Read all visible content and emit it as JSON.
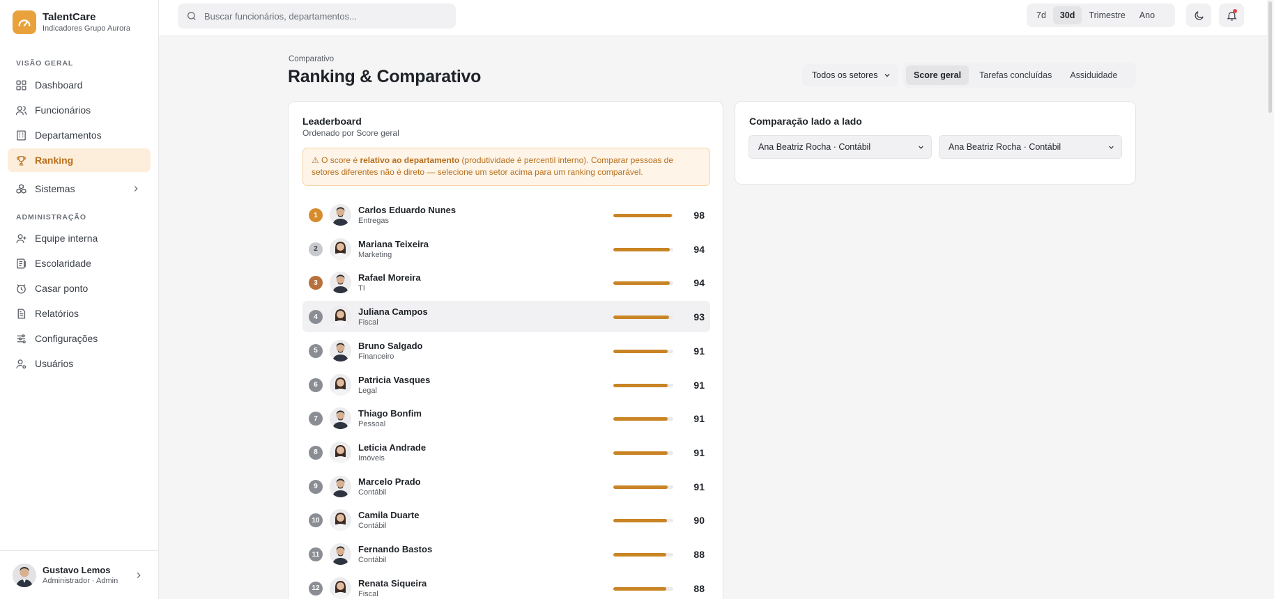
{
  "brand": {
    "name": "TalentCare",
    "subtitle": "Indicadores Grupo Aurora",
    "accent": "#e9a23b"
  },
  "sidebar": {
    "section_overview": "VISÃO GERAL",
    "section_admin": "ADMINISTRAÇÃO",
    "overview_items": [
      {
        "label": "Dashboard",
        "icon": "grid-icon"
      },
      {
        "label": "Funcionários",
        "icon": "users-icon"
      },
      {
        "label": "Departamentos",
        "icon": "building-icon"
      },
      {
        "label": "Ranking",
        "icon": "trophy-icon",
        "active": true
      },
      {
        "label": "Sistemas",
        "icon": "boxes-icon",
        "expandable": true
      }
    ],
    "admin_items": [
      {
        "label": "Equipe interna",
        "icon": "user-plus-icon"
      },
      {
        "label": "Escolaridade",
        "icon": "list-icon"
      },
      {
        "label": "Casar ponto",
        "icon": "clock-icon"
      },
      {
        "label": "Relatórios",
        "icon": "file-icon"
      },
      {
        "label": "Configurações",
        "icon": "sliders-icon"
      },
      {
        "label": "Usuários",
        "icon": "user-gear-icon"
      }
    ],
    "user": {
      "name": "Gustavo Lemos",
      "role": "Administrador · Admin"
    }
  },
  "topbar": {
    "search_placeholder": "Buscar funcionários, departamentos...",
    "periods": [
      "7d",
      "30d",
      "Trimestre",
      "Ano"
    ],
    "active_period": "30d"
  },
  "page": {
    "breadcrumb": "Comparativo",
    "title": "Ranking & Comparativo",
    "sector_filter": "Todos os setores",
    "metric_tabs": [
      "Score geral",
      "Tarefas concluídas",
      "Assiduidade"
    ],
    "active_metric": "Score geral"
  },
  "leaderboard": {
    "title": "Leaderboard",
    "subtitle": "Ordenado por Score geral",
    "notice": {
      "prefix": "⚠ O score é ",
      "bold": "relativo ao departamento",
      "suffix": " (produtividade é percentil interno). Comparar pessoas de setores diferentes não é direto — selecione um setor acima para um ranking comparável."
    },
    "rows": [
      {
        "rank": "1",
        "name": "Carlos Eduardo Nunes",
        "dept": "Entregas",
        "score": "98",
        "gender": "m"
      },
      {
        "rank": "2",
        "name": "Mariana Teixeira",
        "dept": "Marketing",
        "score": "94",
        "gender": "f"
      },
      {
        "rank": "3",
        "name": "Rafael Moreira",
        "dept": "TI",
        "score": "94",
        "gender": "m"
      },
      {
        "rank": "4",
        "name": "Juliana Campos",
        "dept": "Fiscal",
        "score": "93",
        "gender": "f",
        "highlight": true
      },
      {
        "rank": "5",
        "name": "Bruno Salgado",
        "dept": "Financeiro",
        "score": "91",
        "gender": "m"
      },
      {
        "rank": "6",
        "name": "Patricia Vasques",
        "dept": "Legal",
        "score": "91",
        "gender": "f"
      },
      {
        "rank": "7",
        "name": "Thiago Bonfim",
        "dept": "Pessoal",
        "score": "91",
        "gender": "m"
      },
      {
        "rank": "8",
        "name": "Leticia Andrade",
        "dept": "Imóveis",
        "score": "91",
        "gender": "f"
      },
      {
        "rank": "9",
        "name": "Marcelo Prado",
        "dept": "Contábil",
        "score": "91",
        "gender": "m"
      },
      {
        "rank": "10",
        "name": "Camila Duarte",
        "dept": "Contábil",
        "score": "90",
        "gender": "f"
      },
      {
        "rank": "11",
        "name": "Fernando Bastos",
        "dept": "Contábil",
        "score": "88",
        "gender": "m"
      },
      {
        "rank": "12",
        "name": "Renata Siqueira",
        "dept": "Fiscal",
        "score": "88",
        "gender": "f"
      }
    ]
  },
  "comparison": {
    "title": "Comparação lado a lado",
    "left_select": "Ana Beatriz Rocha · Contábil",
    "right_select": "Ana Beatriz Rocha · Contábil"
  },
  "colors": {
    "accent": "#c98424",
    "active_bg": "#fdeedb",
    "active_text": "#b8701e",
    "notice_bg": "#fef4e7"
  }
}
